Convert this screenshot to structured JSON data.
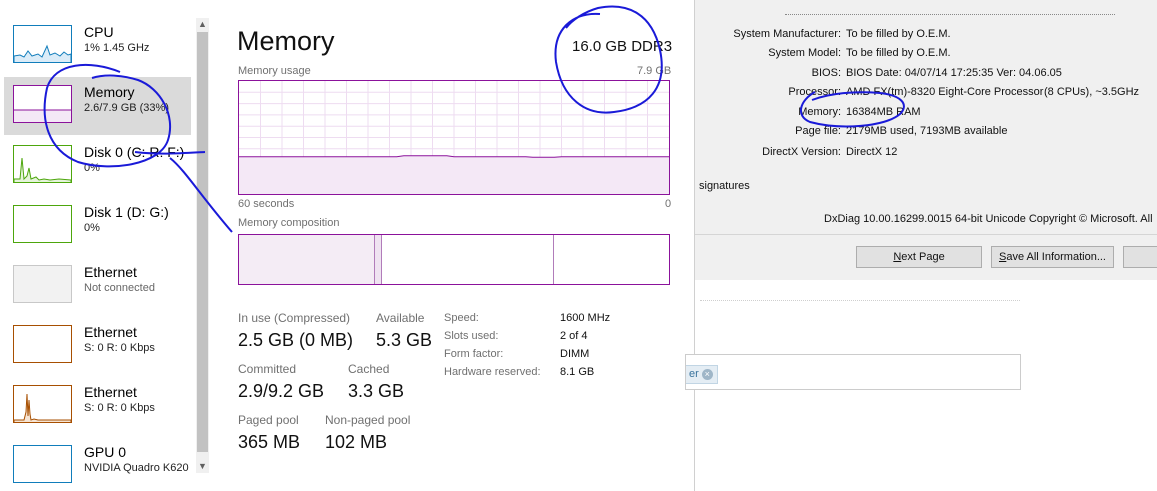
{
  "sidebar": {
    "items": [
      {
        "title": "CPU",
        "sub": "1%  1.45 GHz",
        "icon": "cpu-graph-icon",
        "color": "#117dbb"
      },
      {
        "title": "Memory",
        "sub": "2.6/7.9 GB (33%)",
        "icon": "memory-graph-icon",
        "color": "#8b129b"
      },
      {
        "title": "Disk 0 (C: R: F:)",
        "sub": "0%",
        "icon": "disk-graph-icon",
        "color": "#4da60c"
      },
      {
        "title": "Disk 1 (D: G:)",
        "sub": "0%",
        "icon": "disk-graph-icon",
        "color": "#4da60c"
      },
      {
        "title": "Ethernet",
        "sub": "Not connected",
        "icon": "ethernet-graph-icon",
        "color": "#a7a7a7"
      },
      {
        "title": "Ethernet",
        "sub": "S: 0  R: 0 Kbps",
        "icon": "ethernet-graph-icon",
        "color": "#a74f01"
      },
      {
        "title": "Ethernet",
        "sub": "S: 0  R: 0 Kbps",
        "icon": "ethernet-graph-icon",
        "color": "#a74f01"
      },
      {
        "title": "GPU 0",
        "sub": "NVIDIA Quadro K620",
        "icon": "gpu-graph-icon",
        "color": "#117dbb"
      }
    ],
    "scroll_up": "▲",
    "scroll_down": "▼"
  },
  "memory": {
    "title": "Memory",
    "total": "16.0 GB DDR3",
    "usage_label": "Memory usage",
    "usage_max": "7.9 GB",
    "time_left": "60 seconds",
    "time_right": "0",
    "composition_label": "Memory composition",
    "usage_percent": 33,
    "stats": {
      "in_use_label": "In use (Compressed)",
      "in_use_value": "2.5 GB (0 MB)",
      "available_label": "Available",
      "available_value": "5.3 GB",
      "committed_label": "Committed",
      "committed_value": "2.9/9.2 GB",
      "cached_label": "Cached",
      "cached_value": "3.3 GB",
      "paged_label": "Paged pool",
      "paged_value": "365 MB",
      "nonpaged_label": "Non-paged pool",
      "nonpaged_value": "102 MB"
    },
    "specs": [
      {
        "key": "Speed:",
        "value": "1600 MHz"
      },
      {
        "key": "Slots used:",
        "value": "2 of 4"
      },
      {
        "key": "Form factor:",
        "value": "DIMM"
      },
      {
        "key": "Hardware reserved:",
        "value": "8.1 GB"
      }
    ],
    "accent": "#8b129b"
  },
  "dxdiag": {
    "rows": [
      {
        "key": "System Manufacturer:",
        "value": "To be filled by O.E.M."
      },
      {
        "key": "System Model:",
        "value": "To be filled by O.E.M."
      },
      {
        "key": "BIOS:",
        "value": "BIOS Date: 04/07/14 17:25:35 Ver: 04.06.05"
      },
      {
        "key": "Processor:",
        "value": "AMD FX(tm)-8320 Eight-Core Processor",
        "extra": "(8 CPUs), ~3.5GHz"
      },
      {
        "key": "Memory:",
        "value": "16384MB RAM"
      },
      {
        "key": "Page file:",
        "value": "2179MB used, 7193MB available"
      },
      {
        "key": "DirectX Version:",
        "value": "DirectX 12"
      }
    ],
    "signatures": "signatures",
    "footer": "DxDiag 10.00.16299.0015 64-bit Unicode  Copyright © Microsoft. All",
    "buttons": {
      "next_page_prefix": "N",
      "next_page_rest": "ext Page",
      "save_all_prefix": "S",
      "save_all_rest": "ave All Information..."
    }
  },
  "web": {
    "tag_text": "er",
    "tag_close": "×"
  }
}
